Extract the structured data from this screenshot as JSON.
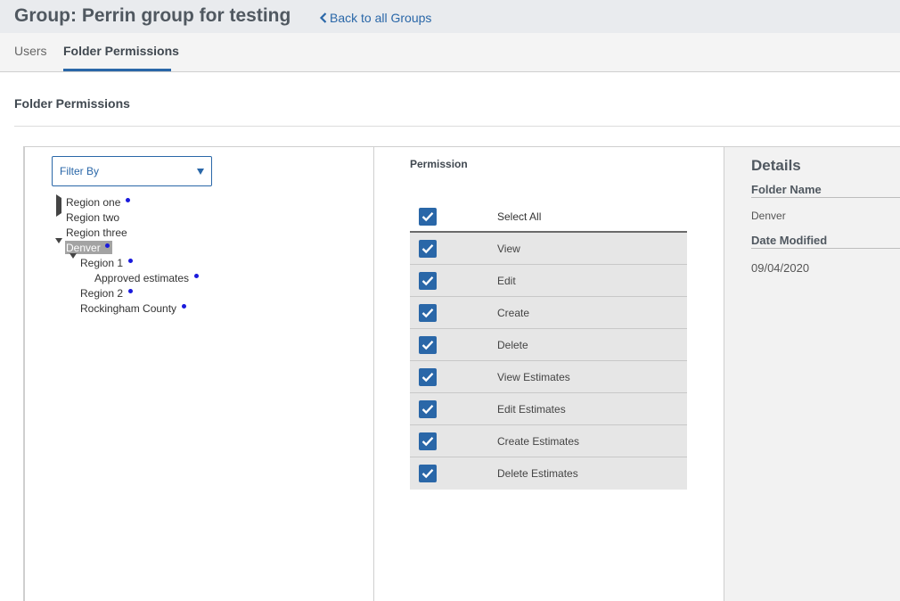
{
  "header": {
    "title": "Group: Perrin group for testing",
    "back_link": "Back to all Groups"
  },
  "tabs": [
    {
      "label": "Users",
      "active": false
    },
    {
      "label": "Folder Permissions",
      "active": true
    }
  ],
  "section": {
    "title": "Folder Permissions"
  },
  "filter": {
    "label": "Filter By",
    "icon": "caret-down-icon"
  },
  "tree": [
    {
      "label": "Region one",
      "expanded": false,
      "has_children": true,
      "dot": true,
      "selected": false
    },
    {
      "label": "Region two",
      "has_children": false,
      "dot": false,
      "selected": false
    },
    {
      "label": "Region three",
      "has_children": false,
      "dot": false,
      "selected": false
    },
    {
      "label": "Denver",
      "expanded": true,
      "has_children": true,
      "dot": true,
      "selected": true
    },
    {
      "label": "Region 1",
      "expanded": true,
      "has_children": true,
      "dot": true,
      "selected": false
    },
    {
      "label": "Approved estimates",
      "has_children": false,
      "dot": true,
      "selected": false
    },
    {
      "label": "Region 2",
      "has_children": false,
      "dot": true,
      "selected": false
    },
    {
      "label": "Rockingham County",
      "has_children": false,
      "dot": true,
      "selected": false
    }
  ],
  "permissions": {
    "header": "Permission",
    "select_all": {
      "label": "Select All",
      "checked": true
    },
    "items": [
      {
        "label": "View",
        "checked": true
      },
      {
        "label": "Edit",
        "checked": true
      },
      {
        "label": "Create",
        "checked": true
      },
      {
        "label": "Delete",
        "checked": true
      },
      {
        "label": "View Estimates",
        "checked": true
      },
      {
        "label": "Edit Estimates",
        "checked": true
      },
      {
        "label": "Create Estimates",
        "checked": true
      },
      {
        "label": "Delete Estimates",
        "checked": true
      }
    ]
  },
  "details": {
    "title": "Details",
    "folder_name_label": "Folder Name",
    "folder_name": "Denver",
    "date_modified_label": "Date Modified",
    "date_modified": "09/04/2020"
  },
  "colors": {
    "accent": "#2a67a8",
    "dot": "#1a1adc",
    "selected_bg": "#a3a3a3"
  }
}
